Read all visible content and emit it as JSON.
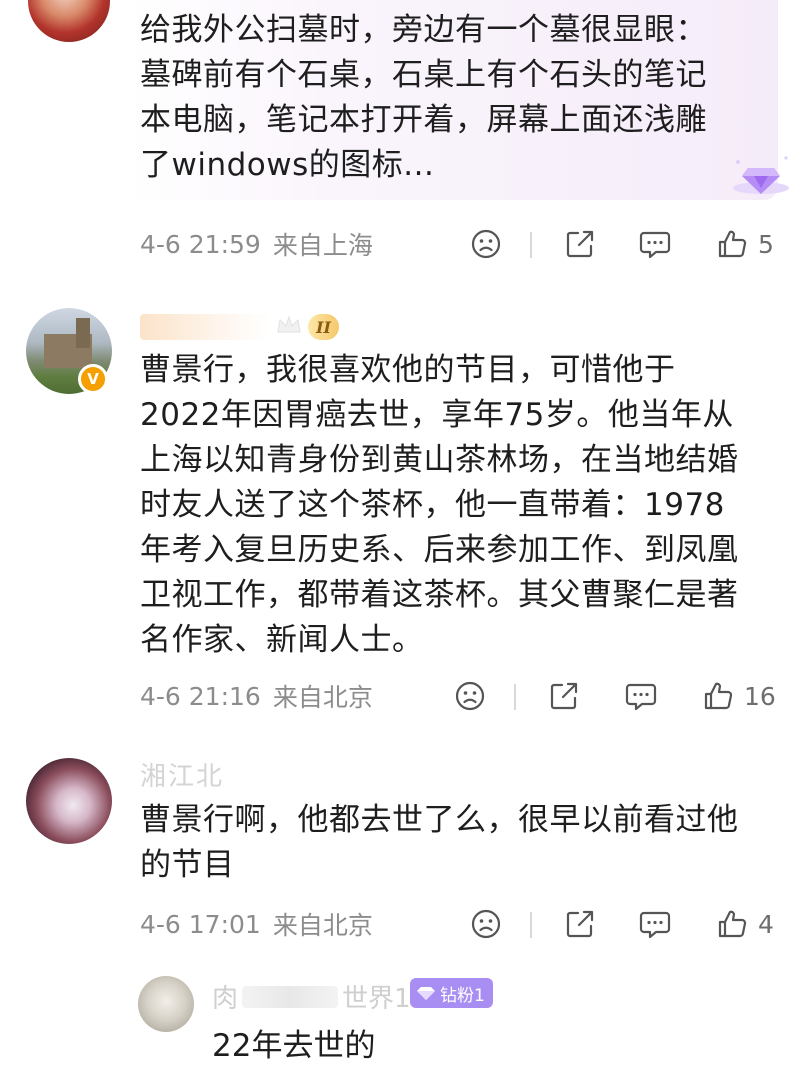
{
  "colors": {
    "meta_text": "#8c8c8c",
    "body_text": "#1e1e1e",
    "highlight_bg": "#f8f2fb",
    "vip_badge": "#f59f00",
    "purple_badge": "#a88ef2"
  },
  "comments": [
    {
      "text_lines": [
        "给我外公扫墓时，旁边有一个墓很显眼：",
        "墓碑前有个石桌，石桌上有个石头的笔记",
        "本电脑，笔记本打开着，屏幕上面还浅雕",
        "了windows的图标..."
      ],
      "time": "4-6 21:59",
      "location": "来自上海",
      "likes": "5"
    },
    {
      "level_badge": "II",
      "text_lines": [
        "曹景行，我很喜欢他的节目，可惜他于",
        "2022年因胃癌去世，享年75岁。他当年从",
        "上海以知青身份到黄山茶林场，在当地结婚",
        "时友人送了这个茶杯，他一直带着：1978",
        "年考入复旦历史系、后来参加工作、到凤凰",
        "卫视工作，都带着这茶杯。其父曹聚仁是著",
        "名作家、新闻人士。"
      ],
      "time": "4-6 21:16",
      "location": "来自北京",
      "likes": "16"
    },
    {
      "username": "湘江北",
      "text_lines": [
        "曹景行啊，他都去世了么，很早以前看过他",
        "的节目"
      ],
      "time": "4-6 17:01",
      "location": "来自北京",
      "likes": "4"
    }
  ],
  "reply": {
    "username": "肉",
    "username_tail": "世界1",
    "badge": "钻粉1",
    "text": "22年去世的"
  }
}
